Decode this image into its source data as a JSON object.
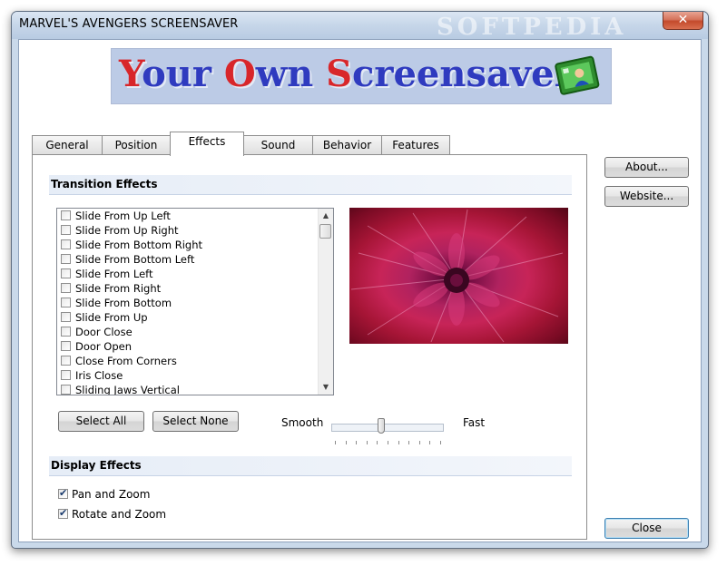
{
  "window": {
    "title": "MARVEL'S AVENGERS SCREENSAVER",
    "close_glyph": "✕",
    "watermark": "SOFTPEDIA"
  },
  "banner": {
    "word1_initial": "Y",
    "word1_rest": "our",
    "word2_initial": "O",
    "word2_rest": "wn",
    "word3_initial": "S",
    "word3_rest": "creensaver",
    "icon": "screensaver-monitor-icon"
  },
  "tabs": [
    {
      "label": "General",
      "active": false
    },
    {
      "label": "Position",
      "active": false
    },
    {
      "label": "Effects",
      "active": true
    },
    {
      "label": "Sound",
      "active": false
    },
    {
      "label": "Behavior",
      "active": false
    },
    {
      "label": "Features",
      "active": false
    }
  ],
  "transition": {
    "header": "Transition Effects",
    "items": [
      {
        "label": "Slide From Up Left",
        "checked": false
      },
      {
        "label": "Slide From Up Right",
        "checked": false
      },
      {
        "label": "Slide From Bottom Right",
        "checked": false
      },
      {
        "label": "Slide From Bottom Left",
        "checked": false
      },
      {
        "label": "Slide From Left",
        "checked": false
      },
      {
        "label": "Slide From Right",
        "checked": false
      },
      {
        "label": "Slide From Bottom",
        "checked": false
      },
      {
        "label": "Slide From Up",
        "checked": false
      },
      {
        "label": "Door Close",
        "checked": false
      },
      {
        "label": "Door Open",
        "checked": false
      },
      {
        "label": "Close From Corners",
        "checked": false
      },
      {
        "label": "Iris Close",
        "checked": false
      },
      {
        "label": "Sliding Jaws Vertical",
        "checked": false
      }
    ],
    "select_all": "Select All",
    "select_none": "Select None",
    "speed_min_label": "Smooth",
    "speed_max_label": "Fast",
    "speed_value": 0.44
  },
  "display": {
    "header": "Display Effects",
    "pan_zoom": {
      "label": "Pan and Zoom",
      "checked": true
    },
    "rotate_zoom": {
      "label": "Rotate and Zoom",
      "checked": true
    }
  },
  "side_buttons": {
    "about": "About...",
    "website": "Website...",
    "close": "Close"
  },
  "scroll": {
    "up": "▲",
    "down": "▼"
  },
  "colors": {
    "accent_blue": "#2f3bbf",
    "accent_red": "#d8262a",
    "frame": "#c9d9ea",
    "close_red": "#c44a2c"
  }
}
